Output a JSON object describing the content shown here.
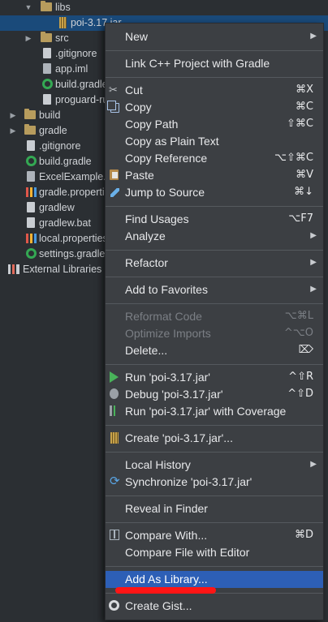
{
  "tree": {
    "items": [
      {
        "label": "libs",
        "indent": 1,
        "arrow": "open",
        "icon": "folder"
      },
      {
        "label": "poi-3.17.jar",
        "indent": 3,
        "arrow": "",
        "icon": "jar",
        "selected": true
      },
      {
        "label": "src",
        "indent": 2,
        "arrow": "closed",
        "icon": "folder"
      },
      {
        "label": ".gitignore",
        "indent": 3,
        "arrow": "",
        "icon": "file"
      },
      {
        "label": "app.iml",
        "indent": 3,
        "arrow": "",
        "icon": "file"
      },
      {
        "label": "build.gradle",
        "indent": 3,
        "arrow": "",
        "icon": "gradle"
      },
      {
        "label": "proguard-rules.pro",
        "indent": 3,
        "arrow": "",
        "icon": "file"
      },
      {
        "label": "build",
        "indent": 1,
        "arrow": "closed",
        "icon": "folder"
      },
      {
        "label": "gradle",
        "indent": 1,
        "arrow": "closed",
        "icon": "folder"
      },
      {
        "label": ".gitignore",
        "indent": 2,
        "arrow": "",
        "icon": "file"
      },
      {
        "label": "build.gradle",
        "indent": 2,
        "arrow": "",
        "icon": "gradle"
      },
      {
        "label": "ExcelExample.iml",
        "indent": 2,
        "arrow": "",
        "icon": "file"
      },
      {
        "label": "gradle.properties",
        "indent": 2,
        "arrow": "",
        "icon": "bars"
      },
      {
        "label": "gradlew",
        "indent": 2,
        "arrow": "",
        "icon": "file"
      },
      {
        "label": "gradlew.bat",
        "indent": 2,
        "arrow": "",
        "icon": "file"
      },
      {
        "label": "local.properties",
        "indent": 2,
        "arrow": "",
        "icon": "bars"
      },
      {
        "label": "settings.gradle",
        "indent": 2,
        "arrow": "",
        "icon": "gradle"
      },
      {
        "label": "External Libraries",
        "indent": 0,
        "arrow": "",
        "icon": "libs"
      }
    ]
  },
  "menu": {
    "new": {
      "label": "New"
    },
    "link_cpp": {
      "label": "Link C++ Project with Gradle"
    },
    "cut": {
      "label": "Cut",
      "shortcut": "⌘X"
    },
    "copy": {
      "label": "Copy",
      "shortcut": "⌘C"
    },
    "copy_path": {
      "label": "Copy Path",
      "shortcut": "⇧⌘C"
    },
    "copy_plain": {
      "label": "Copy as Plain Text"
    },
    "copy_ref": {
      "label": "Copy Reference",
      "shortcut": "⌥⇧⌘C"
    },
    "paste": {
      "label": "Paste",
      "shortcut": "⌘V"
    },
    "jump": {
      "label": "Jump to Source",
      "shortcut": "⌘↓"
    },
    "find_usages": {
      "label": "Find Usages",
      "shortcut": "⌥F7"
    },
    "analyze": {
      "label": "Analyze"
    },
    "refactor": {
      "label": "Refactor"
    },
    "favorites": {
      "label": "Add to Favorites"
    },
    "reformat": {
      "label": "Reformat Code",
      "shortcut": "⌥⌘L"
    },
    "optimize": {
      "label": "Optimize Imports",
      "shortcut": "^⌥O"
    },
    "delete": {
      "label": "Delete...",
      "shortcut": "⌦"
    },
    "run": {
      "label": "Run 'poi-3.17.jar'",
      "shortcut": "^⇧R"
    },
    "debug": {
      "label": "Debug 'poi-3.17.jar'",
      "shortcut": "^⇧D"
    },
    "coverage": {
      "label": "Run 'poi-3.17.jar' with Coverage"
    },
    "create": {
      "label": "Create 'poi-3.17.jar'..."
    },
    "local_history": {
      "label": "Local History"
    },
    "synchronize": {
      "label": "Synchronize 'poi-3.17.jar'"
    },
    "reveal": {
      "label": "Reveal in Finder"
    },
    "compare_with": {
      "label": "Compare With...",
      "shortcut": "⌘D"
    },
    "compare_editor": {
      "label": "Compare File with Editor"
    },
    "add_library": {
      "label": "Add As Library..."
    },
    "create_gist": {
      "label": "Create Gist..."
    }
  },
  "colors": {
    "background": "#2b2f33",
    "menu_bg": "#3c3f43",
    "highlight": "#2d5fb6",
    "selected_row": "#1a4a7a",
    "annotation_underline": "#ff1515"
  }
}
